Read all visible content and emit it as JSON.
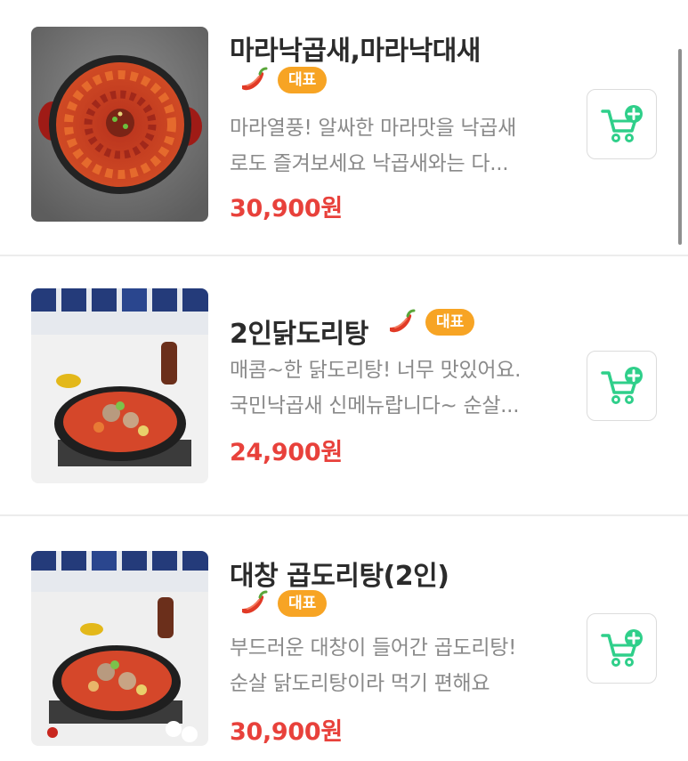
{
  "menu_items": [
    {
      "name": "마라낙곱새,마라낙대새",
      "spicy_icon": "chili-pepper-icon",
      "badge": "대표",
      "description_lines": [
        "마라열풍! 알싸한 마라맛을 낙곱새",
        "로도 즐겨보세요 낙곱새와는 다..."
      ],
      "price": "30,900원",
      "cart_icon": "cart-add-icon"
    },
    {
      "name": "2인닭도리탕",
      "spicy_icon": "chili-pepper-icon",
      "badge": "대표",
      "description_lines": [
        "매콤~한 닭도리탕! 너무 맛있어요.",
        "국민낙곱새 신메뉴랍니다~ 순살..."
      ],
      "price": "24,900원",
      "cart_icon": "cart-add-icon"
    },
    {
      "name": "대창 곱도리탕(2인)",
      "spicy_icon": "chili-pepper-icon",
      "badge": "대표",
      "description_lines": [
        "부드러운 대창이 들어간 곱도리탕!",
        "순살 닭도리탕이라 먹기 편해요"
      ],
      "price": "30,900원",
      "cart_icon": "cart-add-icon"
    }
  ],
  "colors": {
    "price": "#e8413b",
    "badge": "#f7a424",
    "cart_icon": "#2fcf8a",
    "description": "#8a8a8a"
  }
}
